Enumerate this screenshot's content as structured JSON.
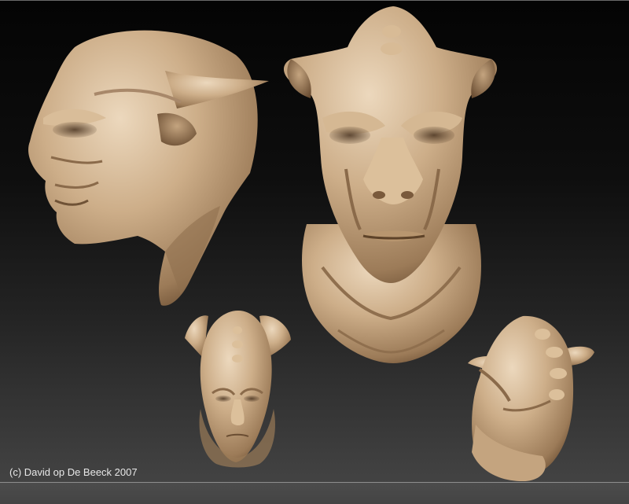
{
  "image": {
    "credit": "(c) David op De Beeck 2007"
  },
  "colors": {
    "clay_highlight": "#e9d3b6",
    "clay_mid": "#c7a882",
    "clay_shadow": "#7d5e40"
  }
}
